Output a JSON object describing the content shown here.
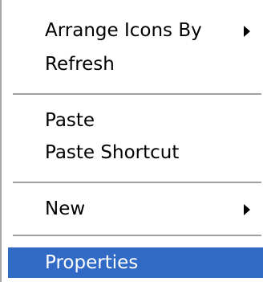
{
  "context_menu": {
    "items": [
      {
        "label": "Arrange Icons By",
        "submenu": true
      },
      {
        "label": "Refresh",
        "submenu": false
      },
      {
        "label": "Paste",
        "submenu": false
      },
      {
        "label": "Paste Shortcut",
        "submenu": false
      },
      {
        "label": "New",
        "submenu": true
      },
      {
        "label": "Properties",
        "submenu": false,
        "selected": true
      }
    ],
    "icons": {
      "submenu_arrow": "triangle-right-icon"
    },
    "colors": {
      "selection_background": "#316ac5",
      "selection_text": "#ffffff",
      "text": "#000000",
      "separator": "#a0a0a0"
    }
  }
}
